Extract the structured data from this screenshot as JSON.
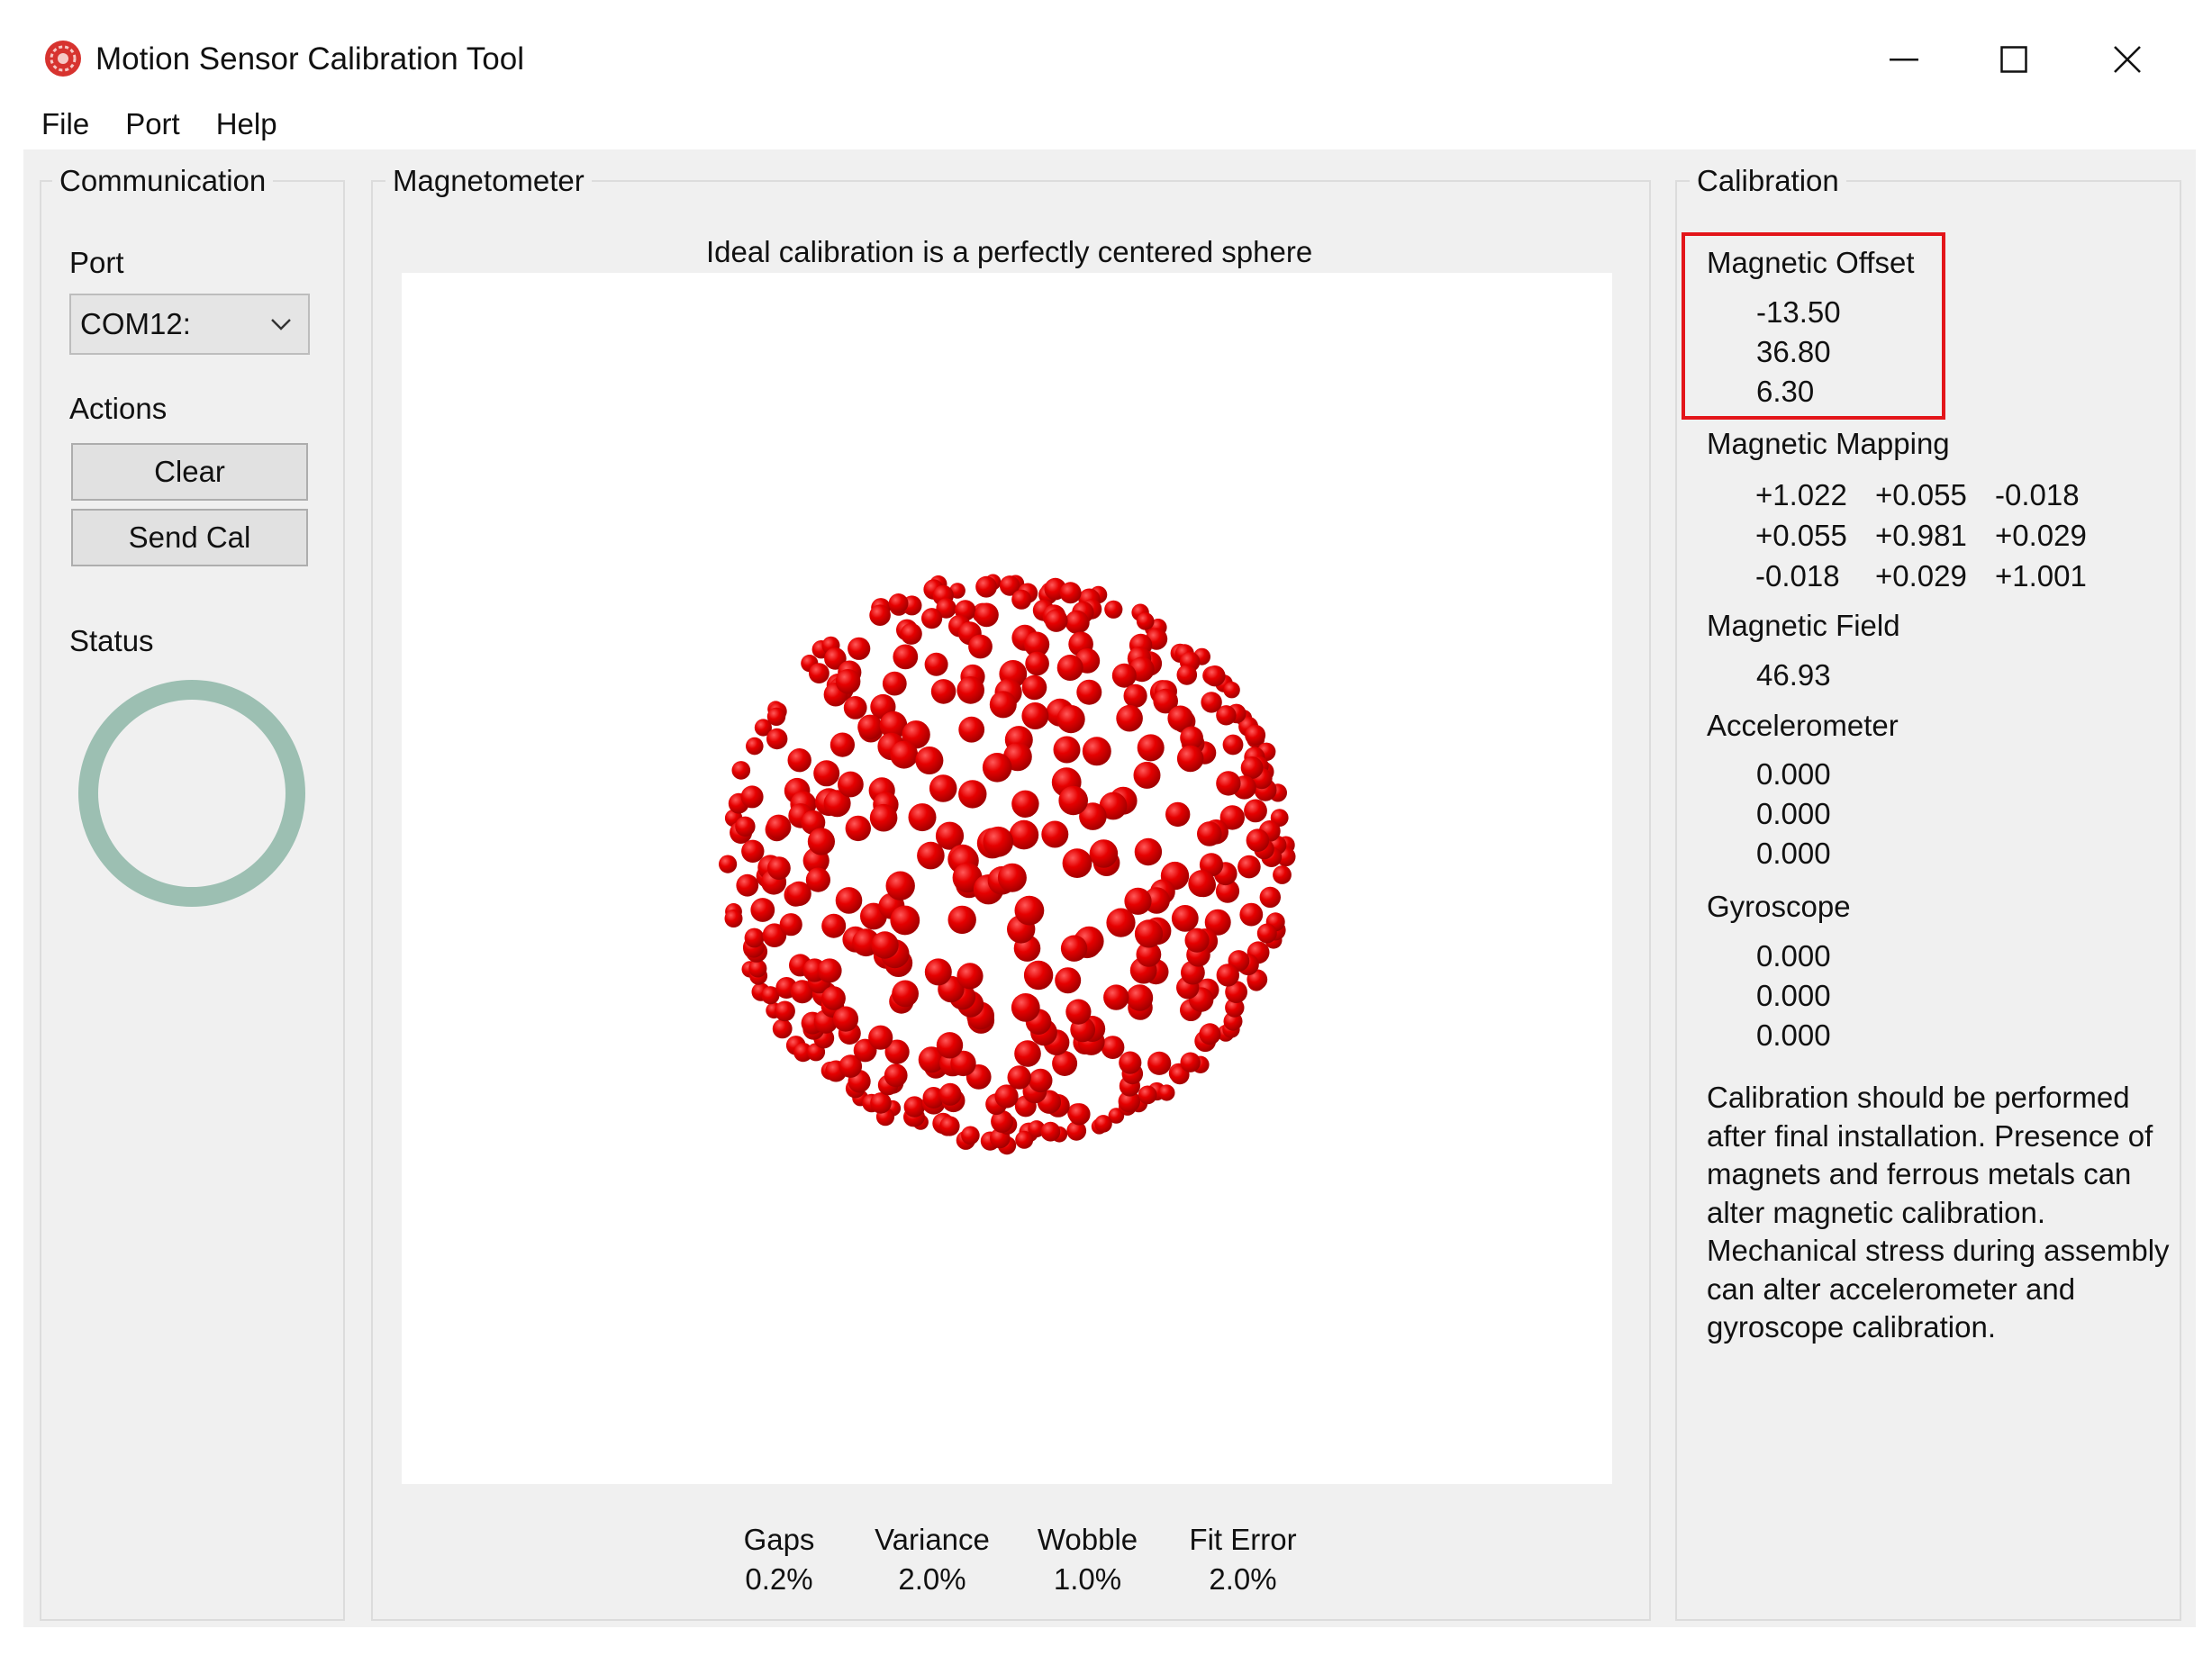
{
  "window": {
    "title": "Motion Sensor Calibration Tool",
    "icon": "app-icon"
  },
  "menu": [
    "File",
    "Port",
    "Help"
  ],
  "communication": {
    "title": "Communication",
    "port_label": "Port",
    "port_value": "COM12:",
    "actions_label": "Actions",
    "clear_label": "Clear",
    "send_cal_label": "Send Cal",
    "status_label": "Status",
    "status_ring_color": "#9cbfb2"
  },
  "magnetometer": {
    "title": "Magnetometer",
    "caption": "Ideal calibration is a perfectly centered sphere",
    "point_color": "#e60000",
    "stats": [
      {
        "label": "Gaps",
        "value": "0.2%"
      },
      {
        "label": "Variance",
        "value": "2.0%"
      },
      {
        "label": "Wobble",
        "value": "1.0%"
      },
      {
        "label": "Fit Error",
        "value": "2.0%"
      }
    ]
  },
  "calibration": {
    "title": "Calibration",
    "offset_label": "Magnetic Offset",
    "offset_values": [
      "-13.50",
      "36.80",
      "6.30"
    ],
    "mapping_label": "Magnetic Mapping",
    "mapping": [
      [
        "+1.022",
        "+0.055",
        "-0.018"
      ],
      [
        "+0.055",
        "+0.981",
        "+0.029"
      ],
      [
        "-0.018",
        "+0.029",
        "+1.001"
      ]
    ],
    "field_label": "Magnetic Field",
    "field_value": "46.93",
    "accel_label": "Accelerometer",
    "accel_values": [
      "0.000",
      "0.000",
      "0.000"
    ],
    "gyro_label": "Gyroscope",
    "gyro_values": [
      "0.000",
      "0.000",
      "0.000"
    ],
    "note": "Calibration should be performed after final installation.  Presence of magnets and ferrous metals can alter magnetic calibration. Mechanical stress during assembly can alter accelerometer and gyroscope calibration.",
    "highlight_color": "#e3151a"
  }
}
